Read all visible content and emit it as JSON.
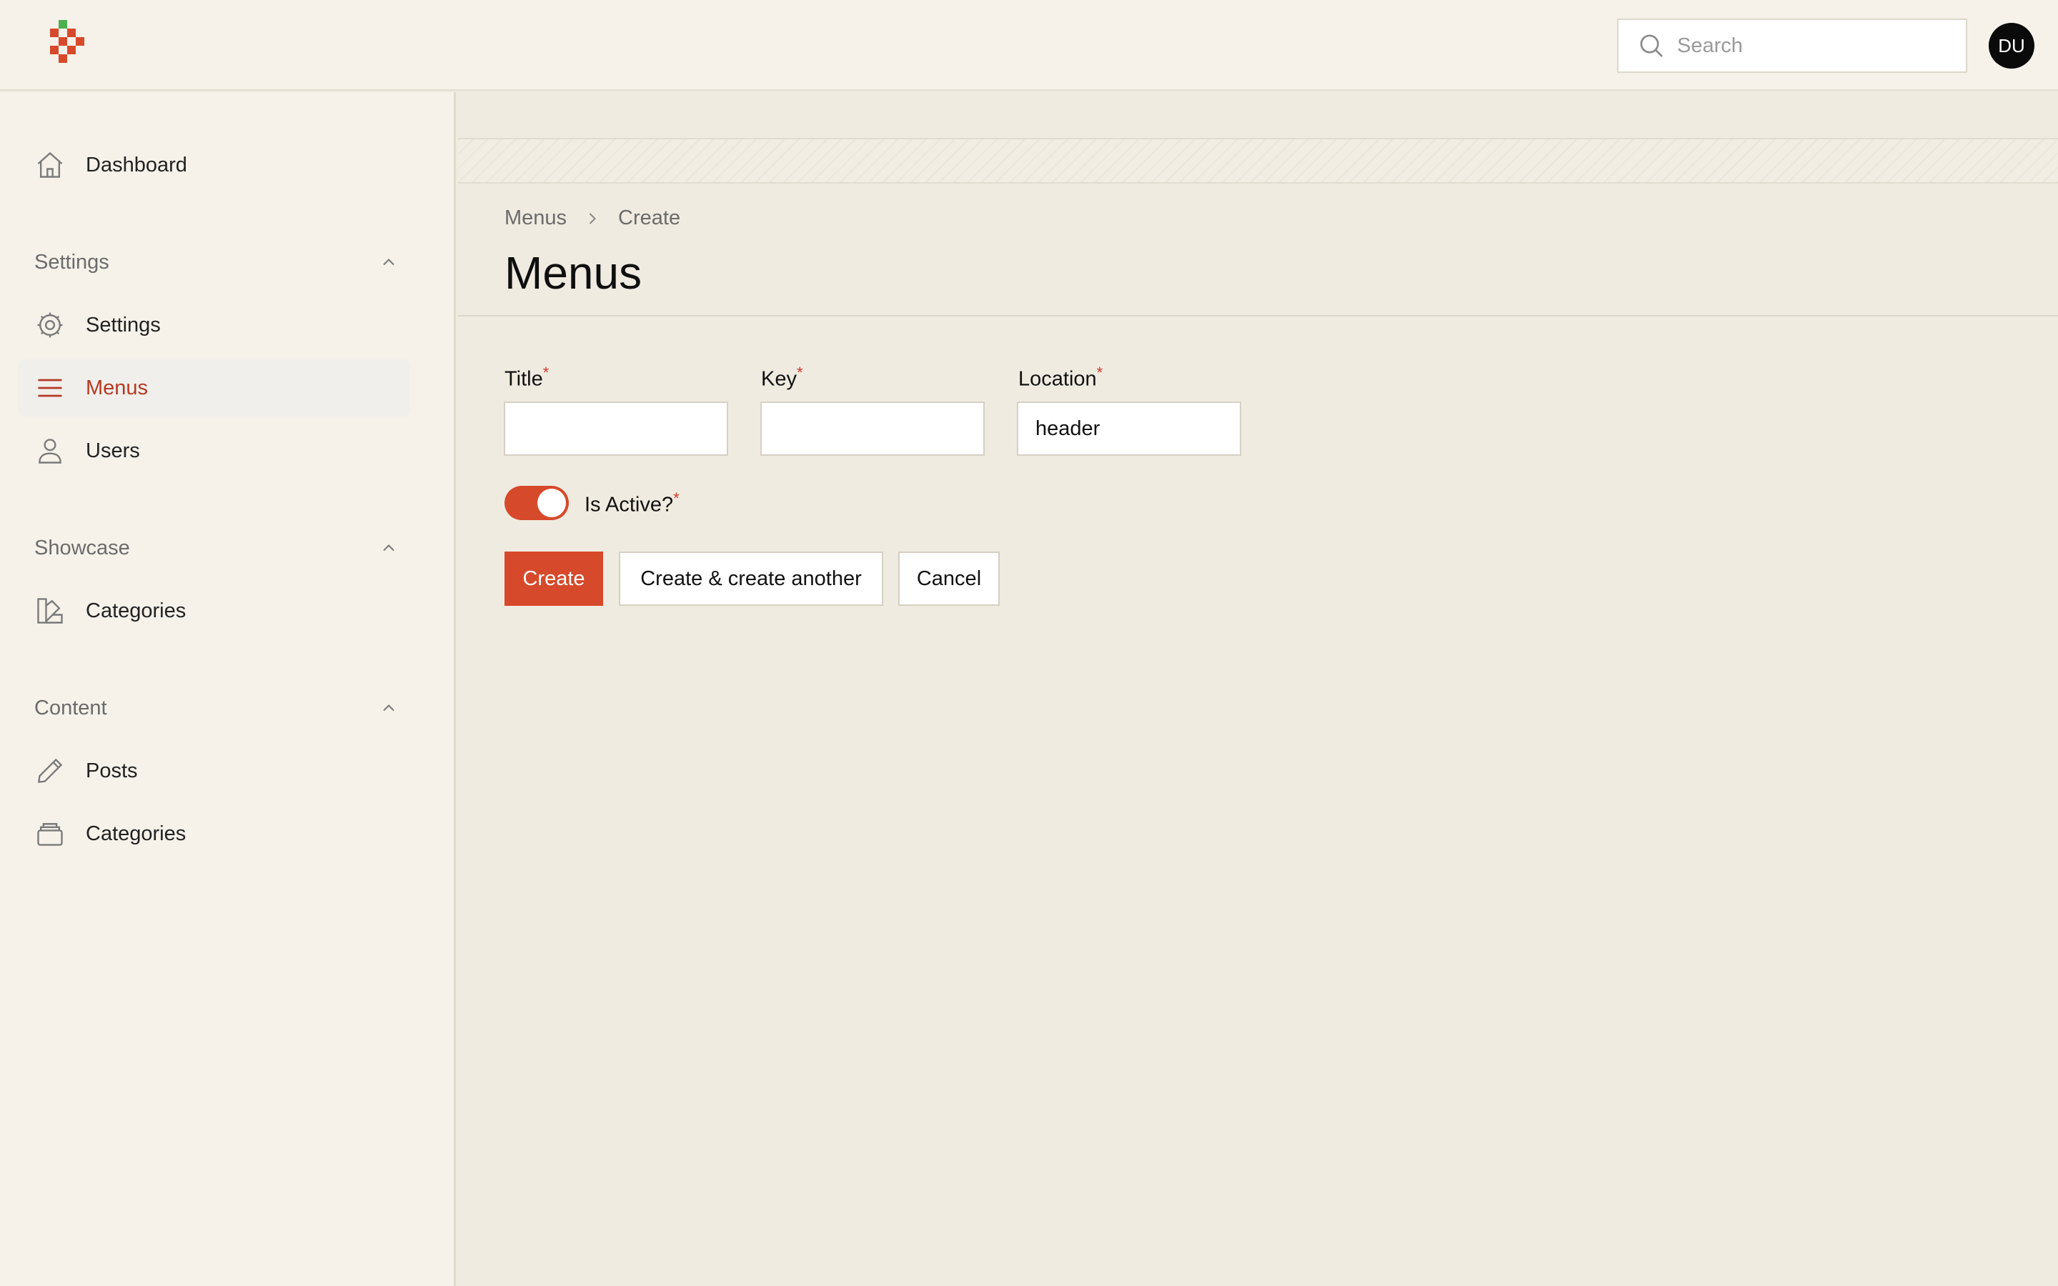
{
  "header": {
    "search_placeholder": "Search",
    "avatar_initials": "DU"
  },
  "sidebar": {
    "dashboard": {
      "label": "Dashboard",
      "icon": "home-icon"
    },
    "groups": [
      {
        "label": "Settings",
        "items": [
          {
            "label": "Settings",
            "icon": "gear-icon"
          },
          {
            "label": "Menus",
            "icon": "menu-lines-icon",
            "active": true
          },
          {
            "label": "Users",
            "icon": "user-icon"
          }
        ]
      },
      {
        "label": "Showcase",
        "items": [
          {
            "label": "Categories",
            "icon": "swatch-icon"
          }
        ]
      },
      {
        "label": "Content",
        "items": [
          {
            "label": "Posts",
            "icon": "pencil-icon"
          },
          {
            "label": "Categories",
            "icon": "stack-icon"
          }
        ]
      }
    ]
  },
  "main": {
    "breadcrumb": [
      "Menus",
      "Create"
    ],
    "title": "Menus",
    "form": {
      "title_label": "Title",
      "title_value": "",
      "key_label": "Key",
      "key_value": "",
      "location_label": "Location",
      "location_value": "header",
      "required_marker": "*",
      "is_active_label": "Is Active?",
      "is_active": true
    },
    "actions": {
      "create": "Create",
      "create_another": "Create & create another",
      "cancel": "Cancel"
    }
  },
  "colors": {
    "accent": "#d6492b",
    "active_nav_text": "#b53a24",
    "background": "#f0ebe0",
    "sidebar_bg": "#f6f2ea"
  }
}
